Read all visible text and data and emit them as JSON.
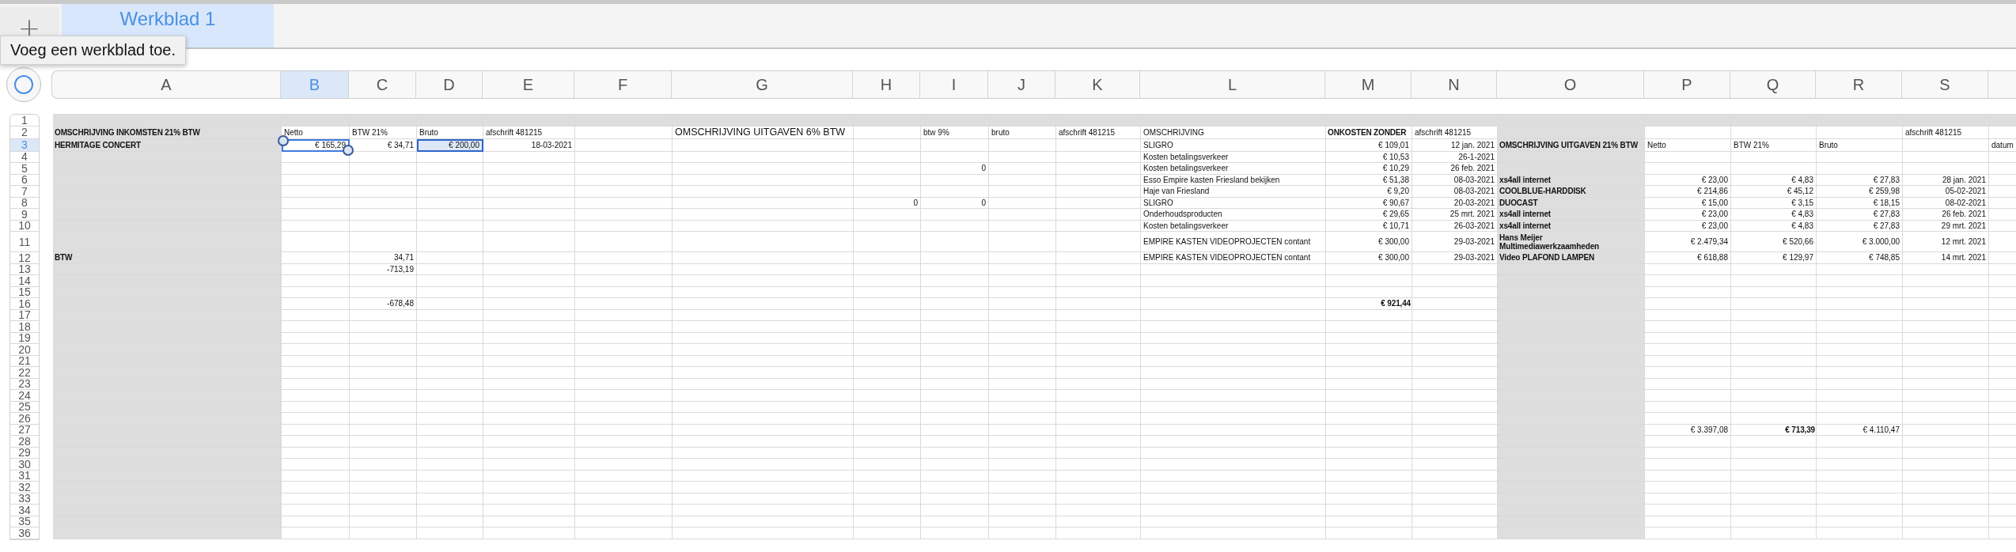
{
  "sheet_tabs": {
    "add_button": "+",
    "tabs": [
      {
        "label": "Werkblad 1",
        "selected": true
      }
    ],
    "tooltip": "Voeg een werkblad toe."
  },
  "columns": [
    {
      "letter": "A",
      "selected": false,
      "shaded": true
    },
    {
      "letter": "B",
      "selected": true,
      "shaded": false
    },
    {
      "letter": "C",
      "selected": false,
      "shaded": false
    },
    {
      "letter": "D",
      "selected": false,
      "shaded": false
    },
    {
      "letter": "E",
      "selected": false,
      "shaded": false
    },
    {
      "letter": "F",
      "selected": false,
      "shaded": false
    },
    {
      "letter": "G",
      "selected": false,
      "shaded": false
    },
    {
      "letter": "H",
      "selected": false,
      "shaded": false
    },
    {
      "letter": "I",
      "selected": false,
      "shaded": false
    },
    {
      "letter": "J",
      "selected": false,
      "shaded": false
    },
    {
      "letter": "K",
      "selected": false,
      "shaded": false
    },
    {
      "letter": "L",
      "selected": false,
      "shaded": false
    },
    {
      "letter": "M",
      "selected": false,
      "shaded": false
    },
    {
      "letter": "N",
      "selected": false,
      "shaded": false
    },
    {
      "letter": "O",
      "selected": false,
      "shaded": true
    },
    {
      "letter": "P",
      "selected": false,
      "shaded": false
    },
    {
      "letter": "Q",
      "selected": false,
      "shaded": false
    },
    {
      "letter": "R",
      "selected": false,
      "shaded": false
    },
    {
      "letter": "S",
      "selected": false,
      "shaded": false
    }
  ],
  "rows": [
    {
      "number": "1",
      "selected": false,
      "shaded": true
    },
    {
      "number": "2",
      "selected": false,
      "shaded": false,
      "cells": {
        "a": {
          "text": "OMSCHRIJVING INKOMSTEN 21% BTW",
          "kind": "label",
          "bold": true,
          "selected": false,
          "highlighted": false
        },
        "b": {
          "text": "Netto",
          "kind": "label",
          "bold": false,
          "selected": false,
          "highlighted": false
        },
        "c": {
          "text": "BTW 21%",
          "kind": "label",
          "bold": false,
          "selected": false,
          "highlighted": false
        },
        "d": {
          "text": "Bruto",
          "kind": "label",
          "bold": false,
          "selected": false,
          "highlighted": false
        },
        "e": {
          "text": "afschrift 481215",
          "kind": "label",
          "bold": false,
          "selected": false,
          "highlighted": false
        },
        "g": {
          "text": "OMSCHRIJVING  UITGAVEN 6% BTW",
          "kind": "heading",
          "bold": false,
          "selected": false,
          "highlighted": false
        },
        "i": {
          "text": "btw 9%",
          "kind": "label",
          "bold": false,
          "selected": false,
          "highlighted": false
        },
        "j": {
          "text": "bruto",
          "kind": "label",
          "bold": false,
          "selected": false,
          "highlighted": false
        },
        "k": {
          "text": "afschrift 481215",
          "kind": "label",
          "bold": false,
          "selected": false,
          "highlighted": false
        },
        "l": {
          "text": "OMSCHRIJVING",
          "kind": "label",
          "bold": false,
          "selected": false,
          "highlighted": false
        },
        "m": {
          "text": "ONKOSTEN ZONDER",
          "kind": "label",
          "bold": true,
          "selected": false,
          "highlighted": false
        },
        "n": {
          "text": "afschrift 481215",
          "kind": "label",
          "bold": false,
          "selected": false,
          "highlighted": false
        },
        "s": {
          "text": "afschrift 481215",
          "kind": "label",
          "bold": false,
          "selected": false,
          "highlighted": false
        }
      }
    },
    {
      "number": "3",
      "selected": true,
      "shaded": false,
      "cells": {
        "a": {
          "text": "HERMITAGE CONCERT",
          "kind": "label",
          "bold": true,
          "selected": false,
          "highlighted": false
        },
        "b": {
          "text": "€ 165,29",
          "kind": "amount",
          "bold": false,
          "selected": true,
          "highlighted": false
        },
        "c": {
          "text": "€ 34,71",
          "kind": "amount",
          "bold": false,
          "selected": false,
          "highlighted": false
        },
        "d": {
          "text": "€ 200,00",
          "kind": "amount",
          "bold": false,
          "selected": false,
          "highlighted": true
        },
        "e": {
          "text": "18-03-2021",
          "kind": "amount",
          "bold": false,
          "selected": false,
          "highlighted": false
        },
        "l": {
          "text": "SLIGRO",
          "kind": "label",
          "bold": false,
          "selected": false,
          "highlighted": false
        },
        "m": {
          "text": "€ 109,01",
          "kind": "amount",
          "bold": false,
          "selected": false,
          "highlighted": false
        },
        "n": {
          "text": "12 jan. 2021",
          "kind": "amount",
          "bold": false,
          "selected": false,
          "highlighted": false
        },
        "o": {
          "text": "OMSCHRIJVING UITGAVEN 21% BTW",
          "kind": "label",
          "bold": true,
          "selected": false,
          "highlighted": false
        },
        "p": {
          "text": "Netto",
          "kind": "label",
          "bold": false,
          "selected": false,
          "highlighted": false
        },
        "q": {
          "text": "BTW 21%",
          "kind": "label",
          "bold": false,
          "selected": false,
          "highlighted": false
        },
        "r": {
          "text": "Bruto",
          "kind": "label",
          "bold": false,
          "selected": false,
          "highlighted": false
        },
        "t": {
          "text": "datum",
          "kind": "label",
          "bold": false,
          "selected": false,
          "highlighted": false
        }
      }
    },
    {
      "number": "4",
      "selected": false,
      "shaded": false,
      "cells": {
        "l": {
          "text": "Kosten betalingsverkeer",
          "kind": "label",
          "bold": false,
          "selected": false,
          "highlighted": false
        },
        "m": {
          "text": "€ 10,53",
          "kind": "amount",
          "bold": false,
          "selected": false,
          "highlighted": false
        },
        "n": {
          "text": "26-1-2021",
          "kind": "amount",
          "bold": false,
          "selected": false,
          "highlighted": false
        }
      }
    },
    {
      "number": "5",
      "selected": false,
      "shaded": false,
      "cells": {
        "i": {
          "text": "0",
          "kind": "amount",
          "bold": false,
          "selected": false,
          "highlighted": false
        },
        "l": {
          "text": "Kosten betalingsverkeer",
          "kind": "label",
          "bold": false,
          "selected": false,
          "highlighted": false
        },
        "m": {
          "text": "€ 10,29",
          "kind": "amount",
          "bold": false,
          "selected": false,
          "highlighted": false
        },
        "n": {
          "text": "26 feb. 2021",
          "kind": "amount",
          "bold": false,
          "selected": false,
          "highlighted": false
        }
      }
    },
    {
      "number": "6",
      "selected": false,
      "shaded": false,
      "cells": {
        "l": {
          "text": "Esso Empire kasten Friesland bekijken",
          "kind": "label",
          "bold": false,
          "selected": false,
          "highlighted": false
        },
        "m": {
          "text": "€ 51,38",
          "kind": "amount",
          "bold": false,
          "selected": false,
          "highlighted": false
        },
        "n": {
          "text": "08-03-2021",
          "kind": "amount",
          "bold": false,
          "selected": false,
          "highlighted": false
        },
        "o": {
          "text": "xs4all internet",
          "kind": "label",
          "bold": true,
          "selected": false,
          "highlighted": false
        },
        "p": {
          "text": "€ 23,00",
          "kind": "amount",
          "bold": false,
          "selected": false,
          "highlighted": false
        },
        "q": {
          "text": "€ 4,83",
          "kind": "amount",
          "bold": false,
          "selected": false,
          "highlighted": false
        },
        "r": {
          "text": "€ 27,83",
          "kind": "amount",
          "bold": false,
          "selected": false,
          "highlighted": false
        },
        "s": {
          "text": "28 jan. 2021",
          "kind": "amount",
          "bold": false,
          "selected": false,
          "highlighted": false
        }
      }
    },
    {
      "number": "7",
      "selected": false,
      "shaded": false,
      "cells": {
        "l": {
          "text": "Haje van Friesland",
          "kind": "label",
          "bold": false,
          "selected": false,
          "highlighted": false
        },
        "m": {
          "text": "€ 9,20",
          "kind": "amount",
          "bold": false,
          "selected": false,
          "highlighted": false
        },
        "n": {
          "text": "08-03-2021",
          "kind": "amount",
          "bold": false,
          "selected": false,
          "highlighted": false
        },
        "o": {
          "text": "COOLBLUE-HARDDISK",
          "kind": "label",
          "bold": true,
          "selected": false,
          "highlighted": false
        },
        "p": {
          "text": "€ 214,86",
          "kind": "amount",
          "bold": false,
          "selected": false,
          "highlighted": false
        },
        "q": {
          "text": "€ 45,12",
          "kind": "amount",
          "bold": false,
          "selected": false,
          "highlighted": false
        },
        "r": {
          "text": "€ 259,98",
          "kind": "amount",
          "bold": false,
          "selected": false,
          "highlighted": false
        },
        "s": {
          "text": "05-02-2021",
          "kind": "amount",
          "bold": false,
          "selected": false,
          "highlighted": false
        }
      }
    },
    {
      "number": "8",
      "selected": false,
      "shaded": false,
      "cells": {
        "h": {
          "text": "0",
          "kind": "amount",
          "bold": false,
          "selected": false,
          "highlighted": false
        },
        "i": {
          "text": "0",
          "kind": "amount",
          "bold": false,
          "selected": false,
          "highlighted": false
        },
        "l": {
          "text": "SLIGRO",
          "kind": "label",
          "bold": false,
          "selected": false,
          "highlighted": false
        },
        "m": {
          "text": "€ 90,67",
          "kind": "amount",
          "bold": false,
          "selected": false,
          "highlighted": false
        },
        "n": {
          "text": "20-03-2021",
          "kind": "amount",
          "bold": false,
          "selected": false,
          "highlighted": false
        },
        "o": {
          "text": "DUOCAST",
          "kind": "label",
          "bold": true,
          "selected": false,
          "highlighted": false
        },
        "p": {
          "text": "€ 15,00",
          "kind": "amount",
          "bold": false,
          "selected": false,
          "highlighted": false
        },
        "q": {
          "text": "€ 3,15",
          "kind": "amount",
          "bold": false,
          "selected": false,
          "highlighted": false
        },
        "r": {
          "text": "€ 18,15",
          "kind": "amount",
          "bold": false,
          "selected": false,
          "highlighted": false
        },
        "s": {
          "text": "08-02-2021",
          "kind": "amount",
          "bold": false,
          "selected": false,
          "highlighted": false
        }
      }
    },
    {
      "number": "9",
      "selected": false,
      "shaded": false,
      "cells": {
        "l": {
          "text": "Onderhoudsproducten",
          "kind": "label",
          "bold": false,
          "selected": false,
          "highlighted": false
        },
        "m": {
          "text": "€ 29,65",
          "kind": "amount",
          "bold": false,
          "selected": false,
          "highlighted": false
        },
        "n": {
          "text": "25 mrt. 2021",
          "kind": "amount",
          "bold": false,
          "selected": false,
          "highlighted": false
        },
        "o": {
          "text": "xs4all internet",
          "kind": "label",
          "bold": true,
          "selected": false,
          "highlighted": false
        },
        "p": {
          "text": "€ 23,00",
          "kind": "amount",
          "bold": false,
          "selected": false,
          "highlighted": false
        },
        "q": {
          "text": "€ 4,83",
          "kind": "amount",
          "bold": false,
          "selected": false,
          "highlighted": false
        },
        "r": {
          "text": "€ 27,83",
          "kind": "amount",
          "bold": false,
          "selected": false,
          "highlighted": false
        },
        "s": {
          "text": "26 feb. 2021",
          "kind": "amount",
          "bold": false,
          "selected": false,
          "highlighted": false
        }
      }
    },
    {
      "number": "10",
      "selected": false,
      "shaded": false,
      "cells": {
        "l": {
          "text": "Kosten betalingsverkeer",
          "kind": "label",
          "bold": false,
          "selected": false,
          "highlighted": false
        },
        "m": {
          "text": "€ 10,71",
          "kind": "amount",
          "bold": false,
          "selected": false,
          "highlighted": false
        },
        "n": {
          "text": "26-03-2021",
          "kind": "amount",
          "bold": false,
          "selected": false,
          "highlighted": false
        },
        "o": {
          "text": "xs4all internet",
          "kind": "label",
          "bold": true,
          "selected": false,
          "highlighted": false
        },
        "p": {
          "text": "€ 23,00",
          "kind": "amount",
          "bold": false,
          "selected": false,
          "highlighted": false
        },
        "q": {
          "text": "€ 4,83",
          "kind": "amount",
          "bold": false,
          "selected": false,
          "highlighted": false
        },
        "r": {
          "text": "€ 27,83",
          "kind": "amount",
          "bold": false,
          "selected": false,
          "highlighted": false
        },
        "s": {
          "text": "29 mrt. 2021",
          "kind": "amount",
          "bold": false,
          "selected": false,
          "highlighted": false
        }
      }
    },
    {
      "number": "11",
      "selected": false,
      "shaded": false,
      "cells": {
        "l": {
          "text": "EMPIRE KASTEN VIDEOPROJECTEN contant",
          "kind": "label",
          "bold": false,
          "selected": false,
          "highlighted": false
        },
        "m": {
          "text": "€ 300,00",
          "kind": "amount",
          "bold": false,
          "selected": false,
          "highlighted": false
        },
        "n": {
          "text": "29-03-2021",
          "kind": "amount",
          "bold": false,
          "selected": false,
          "highlighted": false
        },
        "o": {
          "text": "Hans Meijer Multimediawerkzaamheden",
          "kind": "label",
          "bold": true,
          "selected": false,
          "highlighted": false
        },
        "p": {
          "text": "€ 2.479,34",
          "kind": "amount",
          "bold": false,
          "selected": false,
          "highlighted": false
        },
        "q": {
          "text": "€ 520,66",
          "kind": "amount",
          "bold": false,
          "selected": false,
          "highlighted": false
        },
        "r": {
          "text": "€ 3.000,00",
          "kind": "amount",
          "bold": false,
          "selected": false,
          "highlighted": false
        },
        "s": {
          "text": "12 mrt. 2021",
          "kind": "amount",
          "bold": false,
          "selected": false,
          "highlighted": false
        }
      }
    },
    {
      "number": "12",
      "selected": false,
      "shaded": false,
      "cells": {
        "a": {
          "text": "BTW",
          "kind": "label",
          "bold": true,
          "selected": false,
          "highlighted": false
        },
        "c": {
          "text": "34,71",
          "kind": "amount",
          "bold": false,
          "selected": false,
          "highlighted": false
        },
        "l": {
          "text": "EMPIRE KASTEN VIDEOPROJECTEN contant",
          "kind": "label",
          "bold": false,
          "selected": false,
          "highlighted": false
        },
        "m": {
          "text": "€ 300,00",
          "kind": "amount",
          "bold": false,
          "selected": false,
          "highlighted": false
        },
        "n": {
          "text": "29-03-2021",
          "kind": "amount",
          "bold": false,
          "selected": false,
          "highlighted": false
        },
        "o": {
          "text": "Video PLAFOND LAMPEN",
          "kind": "label",
          "bold": true,
          "selected": false,
          "highlighted": false
        },
        "p": {
          "text": "€ 618,88",
          "kind": "amount",
          "bold": false,
          "selected": false,
          "highlighted": false
        },
        "q": {
          "text": "€ 129,97",
          "kind": "amount",
          "bold": false,
          "selected": false,
          "highlighted": false
        },
        "r": {
          "text": "€ 748,85",
          "kind": "amount",
          "bold": false,
          "selected": false,
          "highlighted": false
        },
        "s": {
          "text": "14 mrt. 2021",
          "kind": "amount",
          "bold": false,
          "selected": false,
          "highlighted": false
        }
      }
    },
    {
      "number": "13",
      "selected": false,
      "shaded": false,
      "cells": {
        "c": {
          "text": "-713,19",
          "kind": "amount",
          "bold": false,
          "selected": false,
          "highlighted": false
        }
      }
    },
    {
      "number": "14",
      "selected": false,
      "shaded": false
    },
    {
      "number": "15",
      "selected": false,
      "shaded": false
    },
    {
      "number": "16",
      "selected": false,
      "shaded": false,
      "cells": {
        "c": {
          "text": "-678,48",
          "kind": "amount",
          "bold": false,
          "selected": false,
          "highlighted": false
        },
        "m": {
          "text": "€ 921,44",
          "kind": "amount",
          "bold": true,
          "selected": false,
          "highlighted": false
        }
      }
    },
    {
      "number": "17",
      "selected": false,
      "shaded": false
    },
    {
      "number": "18",
      "selected": false,
      "shaded": false
    },
    {
      "number": "19",
      "selected": false,
      "shaded": false
    },
    {
      "number": "20",
      "selected": false,
      "shaded": false
    },
    {
      "number": "21",
      "selected": false,
      "shaded": false
    },
    {
      "number": "22",
      "selected": false,
      "shaded": false
    },
    {
      "number": "23",
      "selected": false,
      "shaded": false
    },
    {
      "number": "24",
      "selected": false,
      "shaded": false
    },
    {
      "number": "25",
      "selected": false,
      "shaded": false
    },
    {
      "number": "26",
      "selected": false,
      "shaded": false
    },
    {
      "number": "27",
      "selected": false,
      "shaded": false,
      "cells": {
        "p": {
          "text": "€ 3.397,08",
          "kind": "amount",
          "bold": false,
          "selected": false,
          "highlighted": false
        },
        "q": {
          "text": "€ 713,39",
          "kind": "amount",
          "bold": true,
          "selected": false,
          "highlighted": false
        },
        "r": {
          "text": "€ 4.110,47",
          "kind": "amount",
          "bold": false,
          "selected": false,
          "highlighted": false
        }
      }
    },
    {
      "number": "28",
      "selected": false,
      "shaded": false
    },
    {
      "number": "29",
      "selected": false,
      "shaded": false
    },
    {
      "number": "30",
      "selected": false,
      "shaded": false
    },
    {
      "number": "31",
      "selected": false,
      "shaded": false
    },
    {
      "number": "32",
      "selected": false,
      "shaded": false
    },
    {
      "number": "33",
      "selected": false,
      "shaded": false
    },
    {
      "number": "34",
      "selected": false,
      "shaded": false
    },
    {
      "number": "35",
      "selected": false,
      "shaded": false
    },
    {
      "number": "36",
      "selected": false,
      "shaded": false
    }
  ]
}
